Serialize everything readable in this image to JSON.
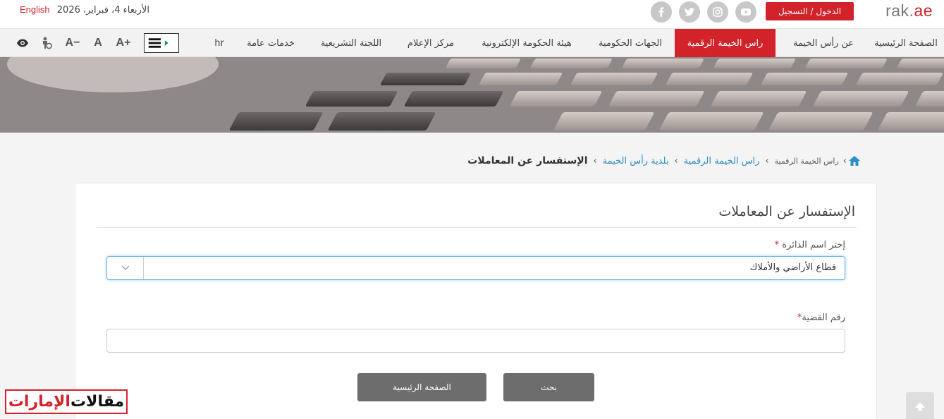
{
  "header": {
    "logo": {
      "main": "rak.",
      "accent": "ae"
    },
    "login_label": "الدخول / التسجيل",
    "date_text": "الأربعاء 4، فبراير، 2026",
    "language_link": "English",
    "social_icons": [
      "youtube-icon",
      "instagram-icon",
      "twitter-icon",
      "facebook-icon"
    ]
  },
  "nav": {
    "items": [
      {
        "label": "الصفحة الرئيسية"
      },
      {
        "label": "عن رأس الخيمة"
      },
      {
        "label": "راس الخيمة الرقمية",
        "active": true
      },
      {
        "label": "الجهات الحكومية"
      },
      {
        "label": "هيئة الحكومة الإلكترونية"
      },
      {
        "label": "مركز الإعلام"
      },
      {
        "label": "اللجنة التشريعية"
      },
      {
        "label": "خدمات عامة"
      },
      {
        "label": "hr"
      }
    ],
    "tools": {
      "font_increase": "A+",
      "font_normal": "A",
      "font_decrease": "A−"
    }
  },
  "breadcrumb": {
    "items": [
      "راس الخيمة الرقمية",
      "راس الخيمة الرقمية",
      "بلدية رأس الخيمة",
      "الإستفسار عن المعاملات"
    ]
  },
  "form": {
    "title": "الإستفسار عن المعاملات",
    "department": {
      "label": "إختر اسم الدائرة",
      "required_mark": "*",
      "value": "قطاع الأراضي والأملاك"
    },
    "case_number": {
      "label": "رقم القضية",
      "required_mark": "*",
      "value": ""
    },
    "buttons": {
      "search": "بحث",
      "home": "الصفحة الرئيسية"
    }
  },
  "watermark": {
    "text_dark": "مقالات",
    "text_red": "الإمارات"
  },
  "colors": {
    "brand_red": "#d2232a",
    "link_blue": "#2b8fc5",
    "button_gray": "#6d6d6d"
  }
}
